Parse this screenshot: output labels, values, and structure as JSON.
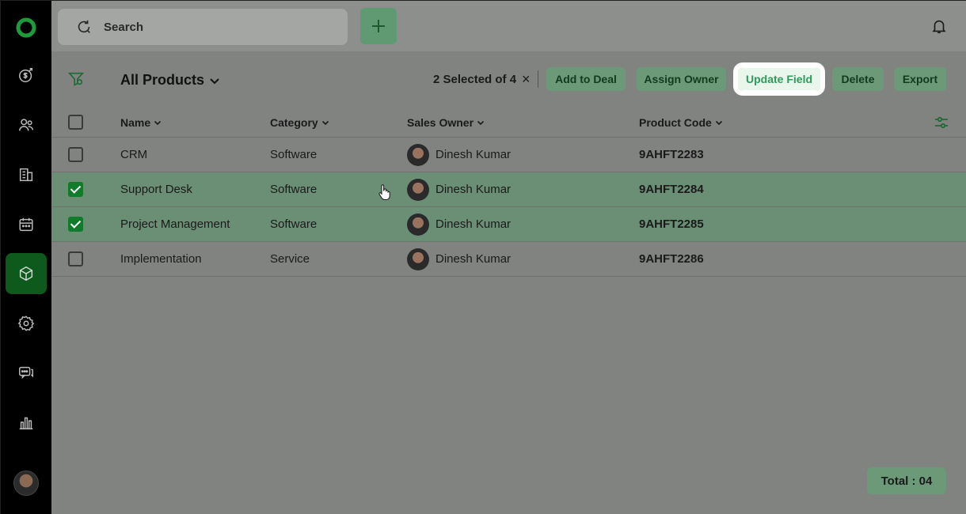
{
  "topbar": {
    "search_placeholder": "Search"
  },
  "toolbar": {
    "view_title": "All Products",
    "selection_text": "2 Selected of 4",
    "clear_symbol": "×",
    "buttons": [
      {
        "label": "Add to Deal"
      },
      {
        "label": "Assign Owner"
      },
      {
        "label": "Update Field"
      },
      {
        "label": "Delete"
      },
      {
        "label": "Export"
      }
    ]
  },
  "table": {
    "columns": [
      "Name",
      "Category",
      "Sales Owner",
      "Product Code"
    ],
    "rows": [
      {
        "name": "CRM",
        "category": "Software",
        "owner": "Dinesh Kumar",
        "code": "9AHFT2283",
        "checked": false
      },
      {
        "name": "Support Desk",
        "category": "Software",
        "owner": "Dinesh Kumar",
        "code": "9AHFT2284",
        "checked": true
      },
      {
        "name": "Project Management",
        "category": "Software",
        "owner": "Dinesh Kumar",
        "code": "9AHFT2285",
        "checked": true
      },
      {
        "name": "Implementation",
        "category": "Service",
        "owner": "Dinesh Kumar",
        "code": "9AHFT2286",
        "checked": false
      }
    ]
  },
  "footer": {
    "total": "Total : 04"
  },
  "sidebar": {
    "items": [
      {
        "icon": "deals-icon"
      },
      {
        "icon": "contacts-icon"
      },
      {
        "icon": "companies-icon"
      },
      {
        "icon": "calendar-icon"
      },
      {
        "icon": "products-icon",
        "active": true
      },
      {
        "icon": "settings-icon"
      },
      {
        "icon": "chat-icon"
      },
      {
        "icon": "reports-icon"
      }
    ]
  },
  "colors": {
    "brand": "#117a2b",
    "accent": "#2e9b5b"
  }
}
